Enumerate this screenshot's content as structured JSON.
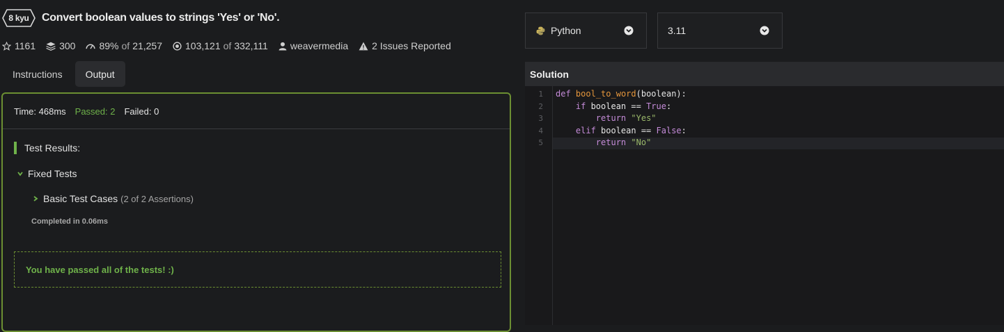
{
  "kata": {
    "rank": "8 kyu",
    "title": "Convert boolean values to strings 'Yes' or 'No'."
  },
  "stats": {
    "stars": "1161",
    "collections": "300",
    "satisfaction": "89%",
    "satisfaction_of": "of",
    "satisfaction_votes": "21,257",
    "completed": "103,121",
    "completed_of": "of",
    "attempts": "332,111",
    "author": "weavermedia",
    "issues": "2 Issues Reported"
  },
  "tabs": [
    {
      "label": "Instructions",
      "active": false
    },
    {
      "label": "Output",
      "active": true
    }
  ],
  "output": {
    "time": "Time: 468ms",
    "passed": "Passed: 2",
    "failed": "Failed: 0",
    "results_heading": "Test Results:",
    "group": "Fixed Tests",
    "test_case": "Basic Test Cases",
    "test_case_count": "(2 of 2 Assertions)",
    "completed_in": "Completed in 0.06ms",
    "pass_message": "You have passed all of the tests! :)"
  },
  "editor": {
    "language": "Python",
    "version": "3.11",
    "panel_title": "Solution",
    "line_numbers": [
      "1",
      "2",
      "3",
      "4",
      "5"
    ]
  },
  "colors": {
    "accent_green": "#6fb24a",
    "panel_border": "#6c8f32",
    "keyword": "#c48bd8",
    "function": "#e5963c",
    "string": "#9ab86a"
  },
  "icons": [
    "star-icon",
    "layers-icon",
    "satisfaction-icon",
    "target-icon",
    "user-icon",
    "warning-icon",
    "python-icon",
    "chevron-down-icon",
    "chevron-right-icon"
  ]
}
